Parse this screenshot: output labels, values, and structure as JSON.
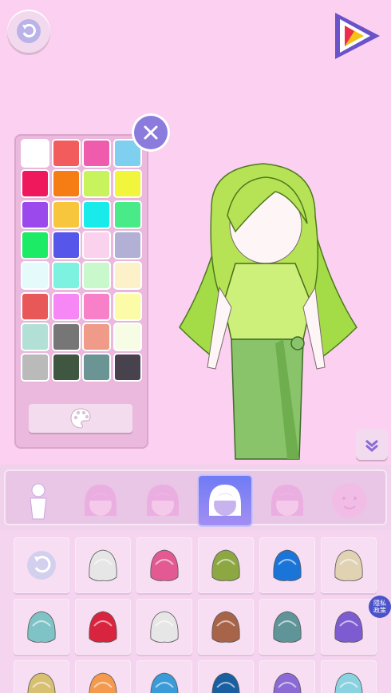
{
  "toolbar": {
    "reset_icon": "refresh-icon",
    "play_icon": "play-icon"
  },
  "palette": {
    "colors": [
      "#ffffff",
      "#f25c5c",
      "#ef5cad",
      "#7ecff0",
      "#f0185c",
      "#f57d13",
      "#c8f35d",
      "#f1f53b",
      "#9b48ec",
      "#f8c63d",
      "#19eaea",
      "#49eb88",
      "#1cec65",
      "#5656eb",
      "#fbd2ee",
      "#b2b0d5",
      "#e4fafb",
      "#7ef2e0",
      "#c9f8cd",
      "#fdf1c9",
      "#e85858",
      "#f687f5",
      "#f880c9",
      "#fbfba8",
      "#b2e0d6",
      "#767676",
      "#f09a89",
      "#f7fde5",
      "#bababa",
      "#3f5640",
      "#6b9494",
      "#48424e"
    ],
    "palette_button_icon": "palette-icon",
    "close_icon": "close-icon"
  },
  "tabs": [
    {
      "name": "body",
      "icon": "body-icon"
    },
    {
      "name": "bangs",
      "icon": "bangs-icon"
    },
    {
      "name": "side-hair",
      "icon": "side-hair-icon"
    },
    {
      "name": "back-hair",
      "icon": "back-hair-icon"
    },
    {
      "name": "ahoge",
      "icon": "ahoge-icon"
    },
    {
      "name": "face",
      "icon": "face-icon"
    }
  ],
  "selected_tab": 3,
  "item_colors": [
    "reset",
    "#e6e6e6",
    "#e35a92",
    "#8da842",
    "#1b75d8",
    "#e1d2b4",
    "#7fc3c6",
    "#d8243f",
    "#e6e6e6",
    "#a86448",
    "#5f9598",
    "#7d5bd0",
    "#d7c072",
    "#f39a4f",
    "#3a9bd8",
    "#1a5fa2",
    "#8c6ad6",
    "#8ad2e0"
  ],
  "privacy_label": "隱私\n政策"
}
